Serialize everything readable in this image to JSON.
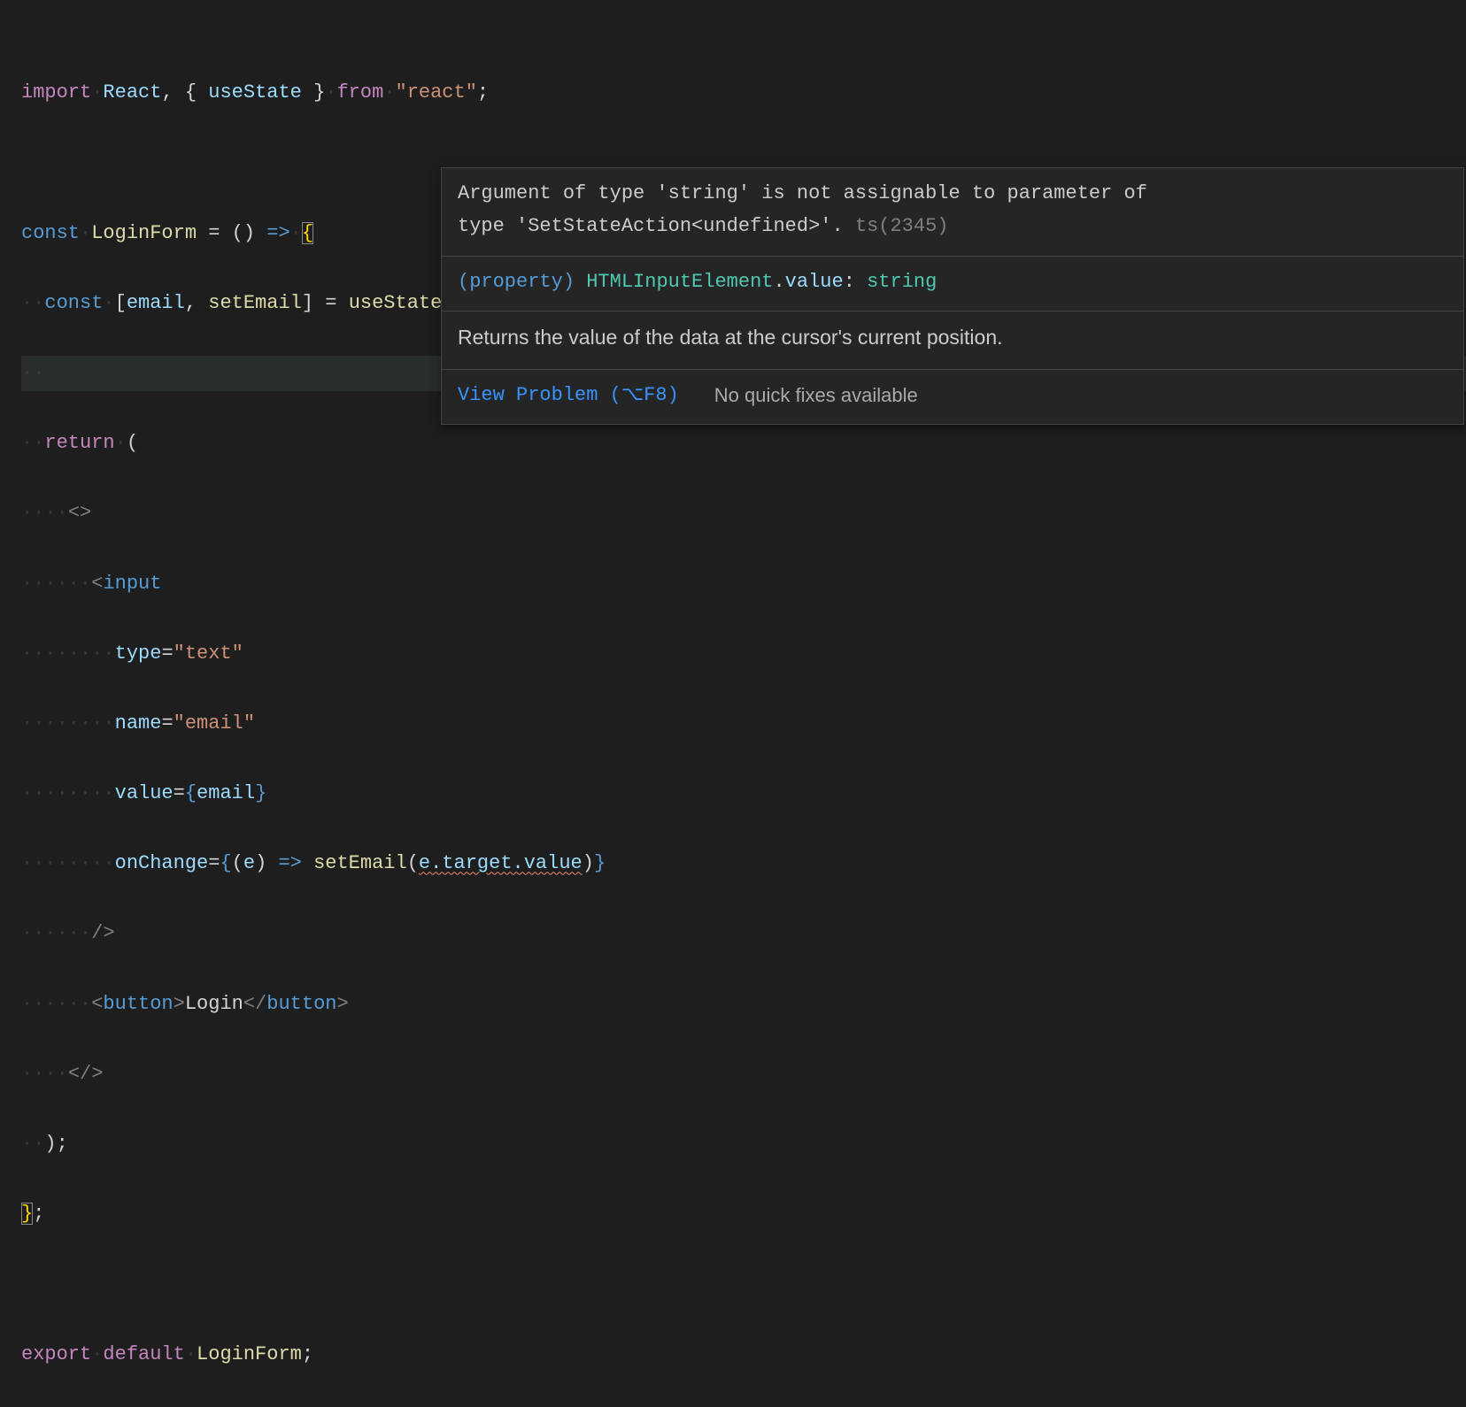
{
  "code": {
    "line1": {
      "import": "import",
      "react": "React",
      "comma": ", ",
      "lbrace": "{ ",
      "useState": "useState",
      "rbrace": " }",
      "from": "from",
      "module": "\"react\"",
      "semi": ";"
    },
    "line3": {
      "const": "const",
      "name": "LoginForm",
      "eq": " = () ",
      "arrow": "=>",
      "brace": "{"
    },
    "line4": {
      "const": "const",
      "lbracket": "[",
      "email": "email",
      "comma": ", ",
      "setEmail": "setEmail",
      "rbracket": "]",
      "eq": " = ",
      "call": "useState",
      "parens": "();"
    },
    "line6": {
      "return": "return",
      "paren": "("
    },
    "line7": {
      "open": "<>"
    },
    "line8": {
      "lt": "<",
      "input": "input"
    },
    "line9": {
      "attr": "type",
      "eq": "=",
      "val": "\"text\""
    },
    "line10": {
      "attr": "name",
      "eq": "=",
      "val": "\"email\""
    },
    "line11": {
      "attr": "value",
      "eq": "=",
      "l": "{",
      "email": "email",
      "r": "}"
    },
    "line12": {
      "attr": "onChange",
      "eq": "=",
      "l": "{",
      "paren1": "(",
      "e": "e",
      "paren2": ")",
      "arrow": " => ",
      "setEmail": "setEmail",
      "p1": "(",
      "err": "e.target.value",
      "p2": ")",
      "r": "}"
    },
    "line13": {
      "close": "/>"
    },
    "line14": {
      "lt1": "<",
      "button": "button",
      "gt1": ">",
      "text": "Login",
      "lt2": "</",
      "button2": "button",
      "gt2": ">"
    },
    "line15": {
      "close": "</>"
    },
    "line16": {
      "close": ");"
    },
    "line17": {
      "close": "};"
    },
    "line19": {
      "export": "export",
      "default": "default",
      "name": "LoginForm",
      "semi": ";"
    }
  },
  "tooltip": {
    "msg1a": "Argument of type 'string' is not assignable to parameter of",
    "msg1b": "type 'SetStateAction<undefined>'.",
    "code": "ts(2345)",
    "sig_kw": "(property)",
    "sig_class": "HTMLInputElement",
    "sig_dot": ".",
    "sig_prop": "value",
    "sig_colon": ": ",
    "sig_type": "string",
    "desc": "Returns the value of the data at the cursor's current position.",
    "view_problem": "View Problem (⌥F8)",
    "no_fix": "No quick fixes available"
  }
}
